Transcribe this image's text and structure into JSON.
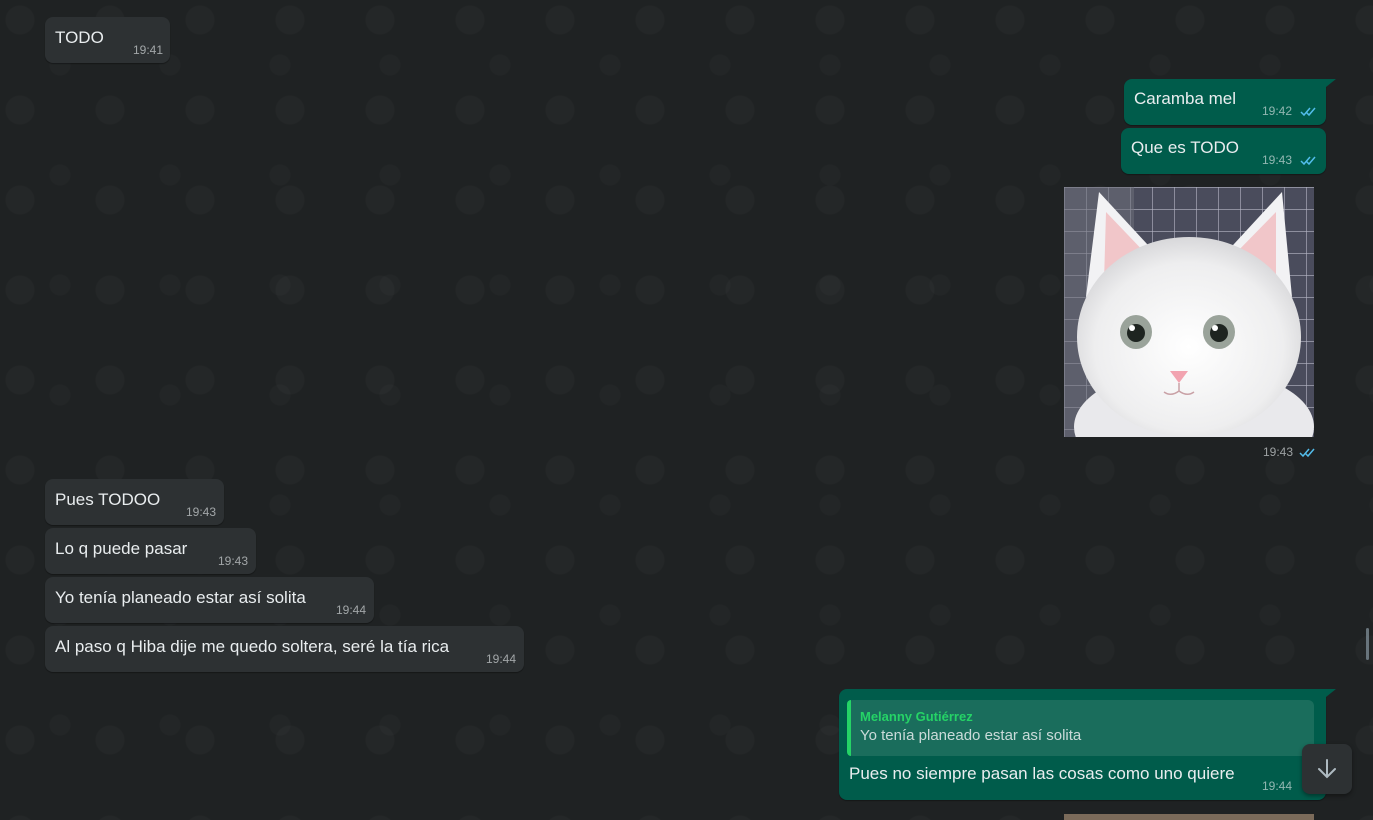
{
  "chat": {
    "messages": [
      {
        "direction": "in",
        "text": "TODO",
        "time": "19:41"
      },
      {
        "direction": "out",
        "text": "Caramba mel",
        "time": "19:42",
        "status": "read"
      },
      {
        "direction": "out",
        "text": "Que es TODO",
        "time": "19:43",
        "status": "read"
      },
      {
        "direction": "out",
        "type": "image",
        "alt_icon": "white-kitten-photo",
        "time": "19:43",
        "status": "read"
      },
      {
        "direction": "in",
        "text": "Pues TODOO",
        "time": "19:43"
      },
      {
        "direction": "in",
        "text": "Lo q puede pasar",
        "time": "19:43"
      },
      {
        "direction": "in",
        "text": "Yo tenía planeado estar así solita",
        "time": "19:44"
      },
      {
        "direction": "in",
        "text": "Al paso q Hiba dije me quedo soltera, seré la tía rica",
        "time": "19:44"
      },
      {
        "direction": "out",
        "reply_to": {
          "name": "Melanny Gutiérrez",
          "text": "Yo tenía planeado estar así solita"
        },
        "text": "Pues no siempre pasan las cosas como uno quiere",
        "time": "19:44"
      }
    ]
  },
  "colors": {
    "background": "#1f2223",
    "incoming_bubble": "#2d3133",
    "outgoing_bubble": "#005c4b",
    "read_ticks": "#53bdeb",
    "quote_name": "#25d366"
  },
  "icons": {
    "read_ticks": "double-check-icon",
    "scroll_down": "arrow-down-icon"
  }
}
